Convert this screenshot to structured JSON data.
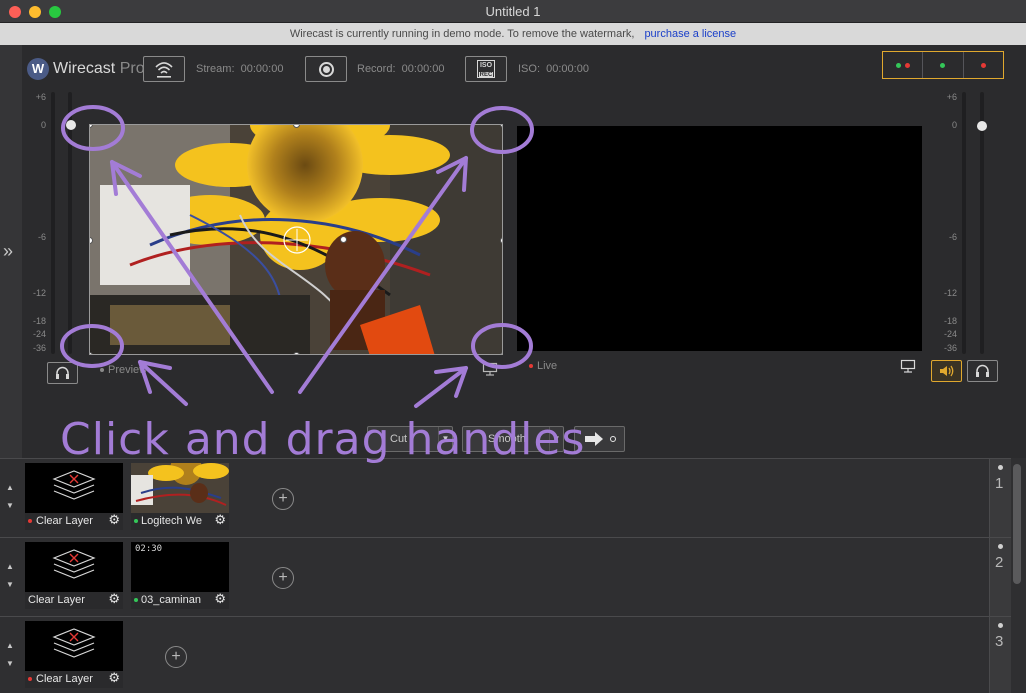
{
  "window": {
    "title": "Untitled 1"
  },
  "banner": {
    "message": "Wirecast is currently running in demo mode. To remove the watermark,",
    "link": "purchase a license"
  },
  "toolbar": {
    "logo_main": "Wirecast",
    "logo_sub": "Pro",
    "stream_label": "Stream:",
    "stream_time": "00:00:00",
    "record_label": "Record:",
    "record_time": "00:00:00",
    "iso_label": "ISO:",
    "iso_time": "00:00:00",
    "iso_icon_top": "ISO",
    "iso_icon_bottom": "REC"
  },
  "meter_scale": [
    "+6",
    "0",
    "-6",
    "-12",
    "-18",
    "-24",
    "-36"
  ],
  "preview": {
    "label": "Preview"
  },
  "live": {
    "label": "Live"
  },
  "transition": {
    "cut": "Cut",
    "smooth": "Smooth"
  },
  "annotation": {
    "text": "Click and drag handles"
  },
  "layers": [
    {
      "number": "1",
      "shots": [
        {
          "label": "Clear Layer",
          "status": "red"
        },
        {
          "label": "Logitech We",
          "status": "green"
        }
      ]
    },
    {
      "number": "2",
      "shots": [
        {
          "label": "Clear Layer",
          "status": "none"
        },
        {
          "label": "03_caminan",
          "status": "green",
          "time": "02:30"
        }
      ]
    },
    {
      "number": "3",
      "shots": [
        {
          "label": "Clear Layer",
          "status": "red"
        }
      ]
    }
  ],
  "colors": {
    "accent": "#e0a82e",
    "annotation": "#a37cd6",
    "live_red": "#e53935",
    "on_green": "#34c759"
  }
}
